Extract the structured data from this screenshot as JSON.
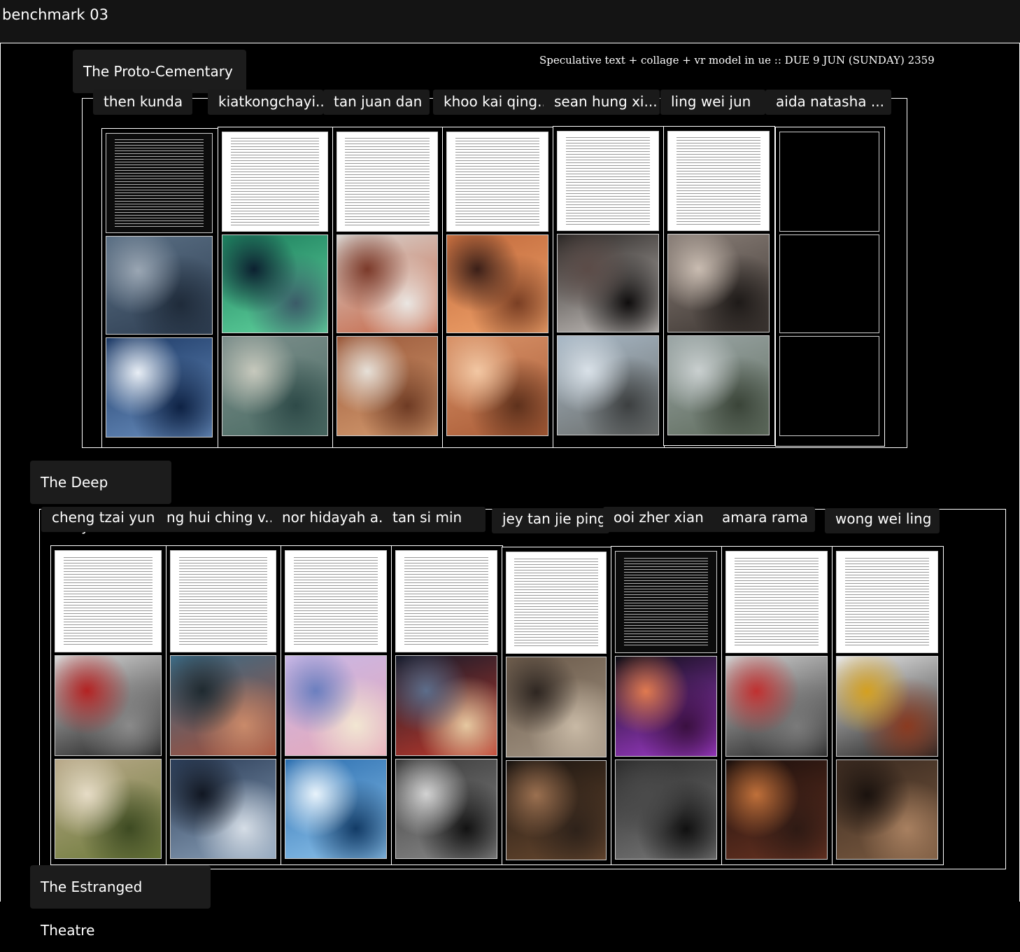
{
  "board_title": "benchmark 03",
  "due_note": "Speculative text + collage + vr model in ue :: DUE 9 JUN (SUNDAY) 2359",
  "sections": [
    {
      "label": "The Proto-Cementary",
      "students": [
        {
          "name": "then kunda",
          "tiles": [
            {
              "kind": "doc-dark"
            },
            {
              "kind": "image",
              "colors": [
                "#5a6f84",
                "#2e3e52",
                "#9aa6b3",
                "#1f2b3a"
              ]
            },
            {
              "kind": "image",
              "colors": [
                "#1d3a66",
                "#6a8fbf",
                "#e8eef5",
                "#0e2244"
              ]
            }
          ]
        },
        {
          "name": "kiatkongchayi..",
          "tiles": [
            {
              "kind": "doc-white"
            },
            {
              "kind": "image",
              "colors": [
                "#1b7d5c",
                "#63d6a0",
                "#0c2030",
                "#3b5b68"
              ]
            },
            {
              "kind": "image",
              "colors": [
                "#7d8f8c",
                "#4a6b63",
                "#c7c9bd",
                "#2e4a48"
              ]
            }
          ]
        },
        {
          "name": "tan juan dan",
          "tiles": [
            {
              "kind": "doc-white"
            },
            {
              "kind": "image",
              "colors": [
                "#d7d2ce",
                "#c66545",
                "#7b3a2a",
                "#eae6e2"
              ]
            },
            {
              "kind": "image",
              "colors": [
                "#9b5a3c",
                "#d49b6f",
                "#e6e0d8",
                "#6e3b24"
              ]
            }
          ]
        },
        {
          "name": "khoo kai qing..",
          "tiles": [
            {
              "kind": "doc-white"
            },
            {
              "kind": "image",
              "colors": [
                "#c26a3c",
                "#f0a36b",
                "#3a1f18",
                "#7a3f24"
              ]
            },
            {
              "kind": "image",
              "colors": [
                "#d99369",
                "#a85a35",
                "#f2c7a3",
                "#5e311c"
              ]
            }
          ]
        },
        {
          "name": "sean hung xi...",
          "tiles": [
            {
              "kind": "doc-white"
            },
            {
              "kind": "image",
              "colors": [
                "#2a2624",
                "#c9c4c0",
                "#5b4b47",
                "#0f0d0d"
              ]
            },
            {
              "kind": "image",
              "colors": [
                "#a8b8c6",
                "#6b6e6c",
                "#d9e1e8",
                "#3c3f40"
              ]
            }
          ]
        },
        {
          "name": "ling wei jun",
          "tiles": [
            {
              "kind": "doc-white"
            },
            {
              "kind": "image",
              "colors": [
                "#8a7f78",
                "#3d3632",
                "#c9bcb1",
                "#1e1a18"
              ]
            },
            {
              "kind": "image",
              "colors": [
                "#9ba6a6",
                "#5f6c5d",
                "#c9cfcf",
                "#3a4438"
              ]
            }
          ]
        },
        {
          "name": "aida natasha ...",
          "tiles": [
            {
              "kind": "empty"
            },
            {
              "kind": "empty"
            },
            {
              "kind": "empty"
            }
          ]
        }
      ]
    },
    {
      "label": "The Deep Library",
      "students": [
        {
          "name": "cheng tzai yun",
          "tiles": [
            {
              "kind": "doc-white"
            },
            {
              "kind": "image",
              "colors": [
                "#d9d9d9",
                "#1b1b1b",
                "#b32222",
                "#8a8a8a"
              ]
            },
            {
              "kind": "image",
              "colors": [
                "#b9a98a",
                "#6d7a3a",
                "#e6dcc6",
                "#3d4a22"
              ]
            }
          ]
        },
        {
          "name": "ng hui ching v..",
          "tiles": [
            {
              "kind": "doc-white"
            },
            {
              "kind": "image",
              "colors": [
                "#3b6b86",
                "#a44d38",
                "#1f2a30",
                "#c98a6a"
              ]
            },
            {
              "kind": "image",
              "colors": [
                "#2b3d58",
                "#8aa0b8",
                "#111722",
                "#d5dde6"
              ]
            }
          ]
        },
        {
          "name": "nor hidayah a..",
          "tiles": [
            {
              "kind": "doc-white"
            },
            {
              "kind": "image",
              "colors": [
                "#c8b7e6",
                "#e7a8b8",
                "#6b7fbf",
                "#f2e6d2"
              ]
            },
            {
              "kind": "image",
              "colors": [
                "#2c6fb0",
                "#8fc4ec",
                "#e8f3fb",
                "#123b66"
              ]
            }
          ]
        },
        {
          "name": "tan si min",
          "tiles": [
            {
              "kind": "doc-white"
            },
            {
              "kind": "image",
              "colors": [
                "#141a2a",
                "#c0392b",
                "#5c6d8a",
                "#e6c8a0"
              ]
            },
            {
              "kind": "image",
              "colors": [
                "#3a3a3a",
                "#8a8a8a",
                "#d2d2d2",
                "#121212"
              ]
            }
          ]
        },
        {
          "name": "jey tan jie ping",
          "tiles": [
            {
              "kind": "doc-white"
            },
            {
              "kind": "image",
              "colors": [
                "#6b5a4a",
                "#a39584",
                "#2e2621",
                "#c8b9a5"
              ]
            },
            {
              "kind": "image",
              "colors": [
                "#1a1410",
                "#6b4a30",
                "#9b7050",
                "#2e221a"
              ]
            }
          ]
        },
        {
          "name": "ooi zher xian",
          "tiles": [
            {
              "kind": "doc-dark"
            },
            {
              "kind": "image",
              "colors": [
                "#0d0d14",
                "#a43cd0",
                "#e07a50",
                "#3a1040"
              ]
            },
            {
              "kind": "image",
              "colors": [
                "#2b2b2b",
                "#7a7a7a",
                "#4a4a4a",
                "#101010"
              ]
            }
          ]
        },
        {
          "name": "amara rama",
          "tiles": [
            {
              "kind": "doc-white"
            },
            {
              "kind": "image",
              "colors": [
                "#d0d0d0",
                "#202020",
                "#c03030",
                "#7a7a7a"
              ]
            },
            {
              "kind": "image",
              "colors": [
                "#1a0f0c",
                "#6a3322",
                "#c0703a",
                "#2e1a14"
              ]
            }
          ]
        },
        {
          "name": "wong wei ling",
          "tiles": [
            {
              "kind": "doc-white"
            },
            {
              "kind": "image",
              "colors": [
                "#e8e8e8",
                "#202020",
                "#d4a020",
                "#8a3a20"
              ]
            },
            {
              "kind": "image",
              "colors": [
                "#3a2a20",
                "#7a5a40",
                "#1a120e",
                "#a88060"
              ]
            }
          ]
        }
      ]
    },
    {
      "label": "The Estranged Theatre",
      "students": []
    }
  ]
}
